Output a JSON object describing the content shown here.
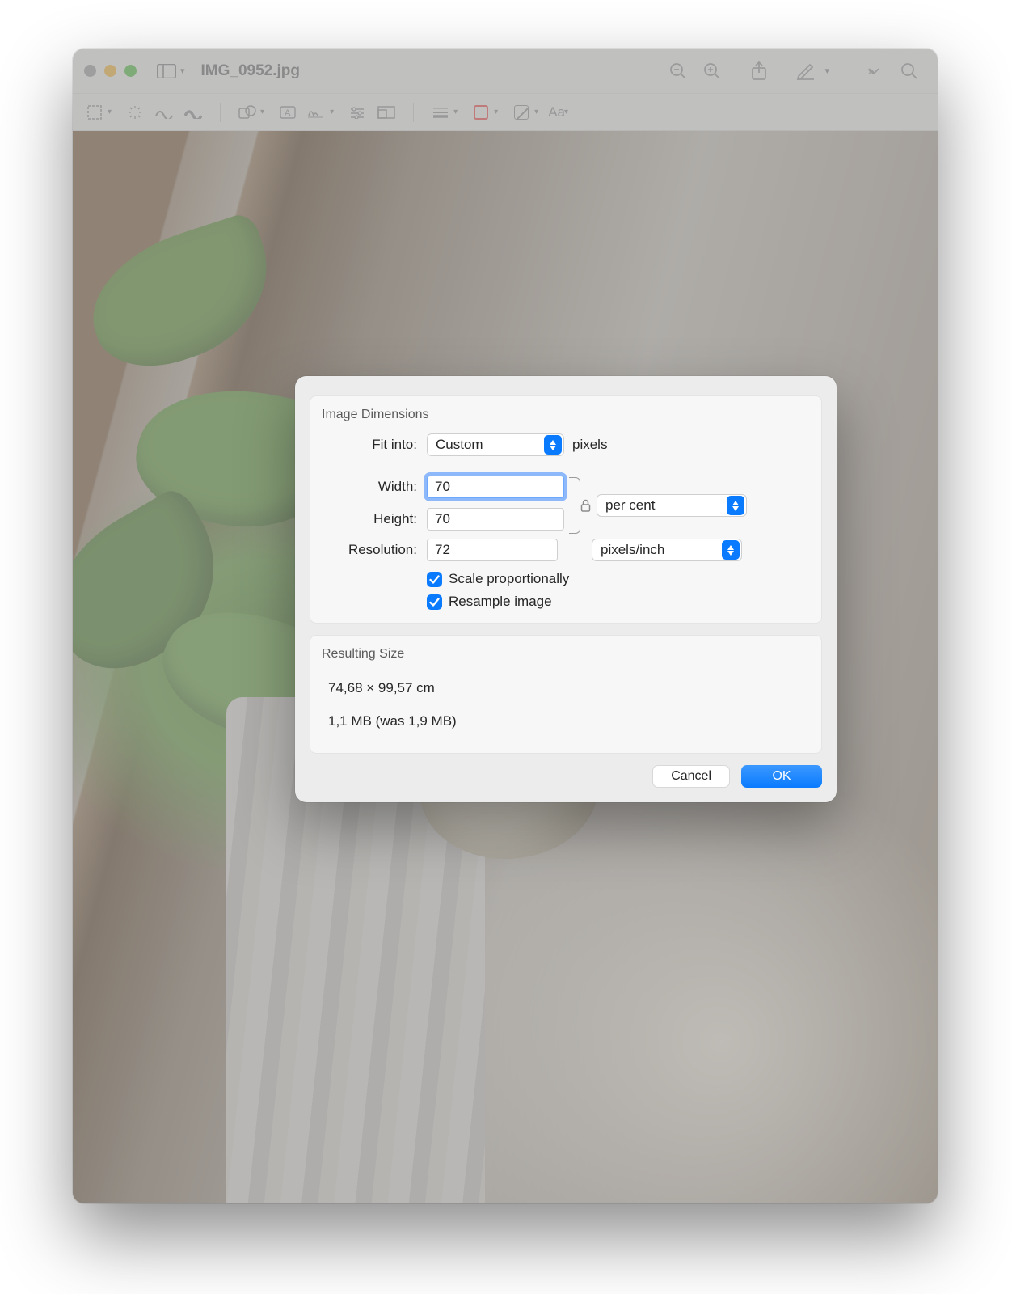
{
  "window": {
    "title": "IMG_0952.jpg"
  },
  "dialog": {
    "group_title": "Image Dimensions",
    "fit_label": "Fit into:",
    "fit_value": "Custom",
    "fit_unit": "pixels",
    "width_label": "Width:",
    "width_value": "70",
    "height_label": "Height:",
    "height_value": "70",
    "wh_unit": "per cent",
    "resolution_label": "Resolution:",
    "resolution_value": "72",
    "resolution_unit": "pixels/inch",
    "scale_label": "Scale proportionally",
    "resample_label": "Resample image",
    "result_title": "Resulting Size",
    "result_dims": "74,68 × 99,57 cm",
    "result_size": "1,1 MB (was 1,9 MB)",
    "cancel": "Cancel",
    "ok": "OK"
  },
  "markup": {
    "aa": "Aa"
  }
}
